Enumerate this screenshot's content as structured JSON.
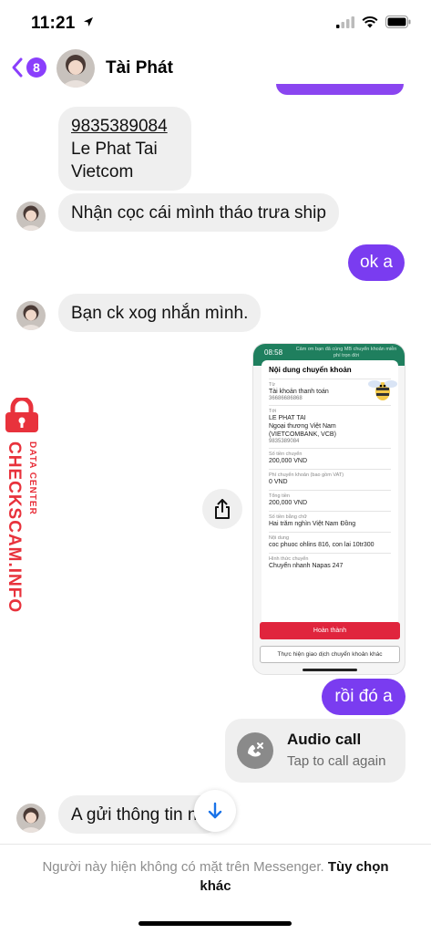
{
  "status_bar": {
    "time": "11:21"
  },
  "header": {
    "unread_count": "8",
    "contact_name": "Tài Phát"
  },
  "messages": {
    "bank_info": {
      "account": "9835389084",
      "name": "Le Phat Tai",
      "bank": "Vietcom"
    },
    "msg1": "Nhận cọc cái mình tháo trưa ship",
    "out1": "ok a",
    "msg2": "Bạn ck xog nhắn mình.",
    "out2": "rồi đó a",
    "msg3": "A gửi thông tin n"
  },
  "receipt": {
    "time": "08:58",
    "banner": "Cảm ơn bạn đã cùng MB chuyển khoản miễn phí trọn đời",
    "title": "Nội dung chuyển khoản",
    "from_label": "Từ",
    "from_value": "Tài khoản thanh toán",
    "from_number": "36686686868",
    "to_label": "Tới",
    "to_name": "LE PHAT TAI",
    "to_bank": "Ngoại thương Việt Nam",
    "to_bank_full": "(VIETCOMBANK, VCB)",
    "to_number": "9835389084",
    "amount_label": "Số tiền chuyển",
    "amount_value": "200,000 VND",
    "fee_label": "Phí chuyển khoản (bao gồm VAT)",
    "fee_value": "0 VND",
    "total_label": "Tổng tiền",
    "total_value": "200,000 VND",
    "words_label": "Số tiền bằng chữ",
    "words_value": "Hai trăm nghìn Việt Nam Đồng",
    "content_label": "Nội dung",
    "content_value": "coc phuoc ohlins 816, con lai 10tr300",
    "method_label": "Hình thức chuyển",
    "method_value": "Chuyển nhanh Napas 247",
    "done_button": "Hoàn thành",
    "other_button": "Thực hiện giao dịch chuyển khoản khác"
  },
  "call": {
    "title": "Audio call",
    "subtitle": "Tap to call again"
  },
  "footer": {
    "notice": "Người này hiện không có mặt trên Messenger.",
    "action": "Tùy chọn khác"
  },
  "watermark": {
    "brand": "CHECKSCAM.INFO",
    "sub": "DATA CENTER"
  },
  "colors": {
    "accent": "#7a3cf0",
    "incoming_bubble": "#efefef",
    "watermark": "#e8323c"
  },
  "icons": [
    "location-arrow-icon",
    "signal-icon",
    "wifi-icon",
    "battery-icon",
    "back-chevron-icon",
    "share-icon",
    "call-missed-icon",
    "arrow-down-icon",
    "lock-icon"
  ]
}
